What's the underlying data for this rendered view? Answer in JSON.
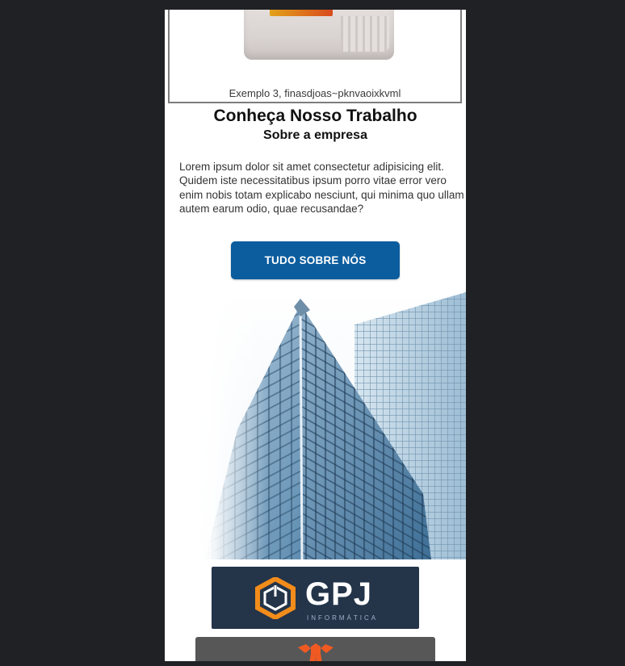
{
  "product": {
    "caption": "Exemplo 3, finasdjoas~pknvaoixkvml"
  },
  "about": {
    "title": "Conheça Nosso Trabalho",
    "subtitle": "Sobre a empresa",
    "body": "Lorem ipsum dolor sit amet consectetur adipisicing elit. Quidem iste necessitatibus ipsum porro vitae error vero enim nobis totam explicabo nesciunt, qui minima quo ullam autem earum odio, quae recusandae?",
    "button_label": "TUDO SOBRE NÓS"
  },
  "partners": {
    "logo1_name": "GPJ",
    "logo1_sub": "INFORMÁTICA"
  },
  "colors": {
    "page_background": "#202124",
    "button": "#0b5d9e",
    "logo1_background": "#243449",
    "logo_accent": "#f28c1b",
    "logo2_background": "#575757",
    "logo2_accent": "#f05a22"
  }
}
